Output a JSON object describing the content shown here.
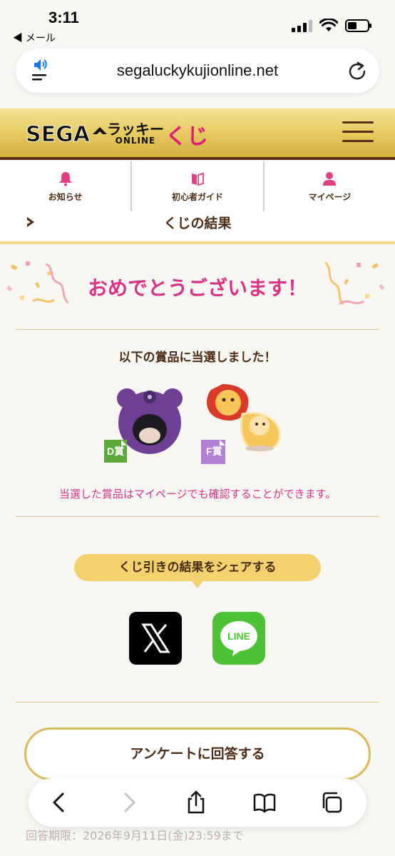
{
  "status_bar": {
    "time": "3:11",
    "back_label": "◀ メール"
  },
  "browser": {
    "url": "segaluckykujionline.net"
  },
  "site": {
    "logo": {
      "sega": "SEGA",
      "lucky": "ラッキー",
      "online": "ONLINE",
      "kuji": "くじ"
    }
  },
  "nav": {
    "items": [
      {
        "label": "お知らせ",
        "icon": "bell-icon"
      },
      {
        "label": "初心者ガイド",
        "icon": "book-icon"
      },
      {
        "label": "マイページ",
        "icon": "person-icon"
      }
    ]
  },
  "section": {
    "title": "くじの結果"
  },
  "result": {
    "congrats": "おめでとうございます！",
    "won_heading": "以下の賞品に当選しました！",
    "prizes": [
      {
        "badge": "D賞",
        "badge_color": "#5aa83c"
      },
      {
        "badge": "F賞",
        "badge_color": "#b07fd6"
      }
    ],
    "note": "当選した賞品はマイページでも確認することができます。"
  },
  "share": {
    "label": "くじ引きの結果をシェアする",
    "x_icon": "x-logo-icon",
    "line_label": "LINE"
  },
  "survey": {
    "label": "アンケートに回答する"
  },
  "deadline": "回答期限：2026年9月11日(金)23:59まで",
  "colors": {
    "accent_pink": "#d63384",
    "brown": "#4a2c17",
    "gold": "#f3d16e"
  }
}
